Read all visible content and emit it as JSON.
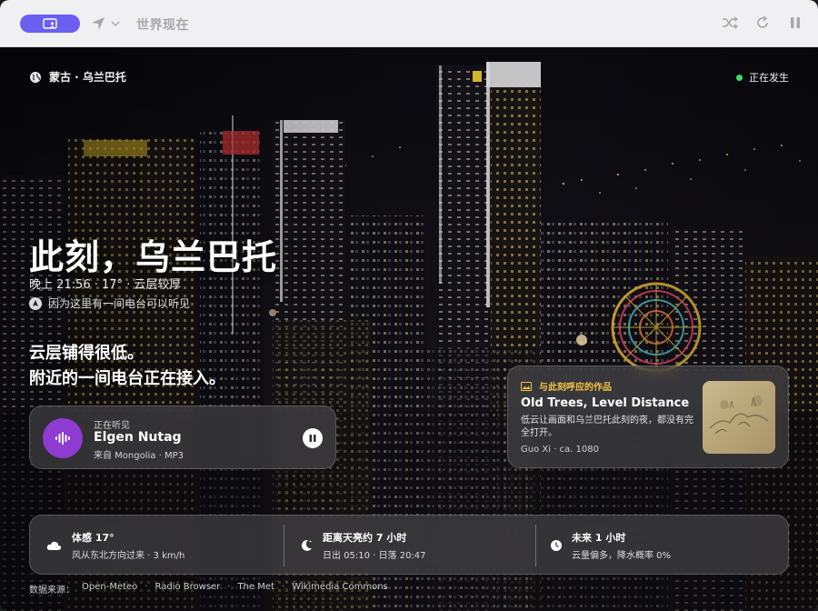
{
  "titlebar": {
    "title": "世界现在",
    "accent": "#6a5ff0"
  },
  "location": {
    "label": "蒙古 · 乌兰巴托"
  },
  "live": {
    "label": "正在发生",
    "color": "#3ddc6b"
  },
  "hero": {
    "title": "此刻，乌兰巴托",
    "subtitle": "晚上 21:56 · 17° · 云层较厚",
    "reason": "因为这里有一间电台可以听见",
    "line1": "云层铺得很低。",
    "line2": "附近的一间电台正在接入。"
  },
  "now_playing": {
    "label": "正在听见",
    "name": "Elgen Nutag",
    "source": "来自 Mongolia · MP3",
    "avatar_color": "#8e3bd1"
  },
  "artwork": {
    "header": "与此刻呼应的作品",
    "title": "Old Trees, Level Distance",
    "description": "低云让画面和乌兰巴托此刻的夜，都没有完全打开。",
    "credit": "Guo Xi · ca. 1080",
    "header_color": "#f5c542"
  },
  "info": {
    "weather_title": "体感 17°",
    "weather_sub": "风从东北方向过来 · 3 km/h",
    "sun_title": "距离天亮约 7 小时",
    "sun_sub": "日出 05:10 · 日落 20:47",
    "forecast_title": "未来 1 小时",
    "forecast_sub": "云量偏多，降水概率 0%"
  },
  "footer": {
    "label": "数据来源：",
    "sources": [
      "Open-Meteo",
      "Radio Browser",
      "The Met",
      "Wikimedia Commons"
    ]
  }
}
